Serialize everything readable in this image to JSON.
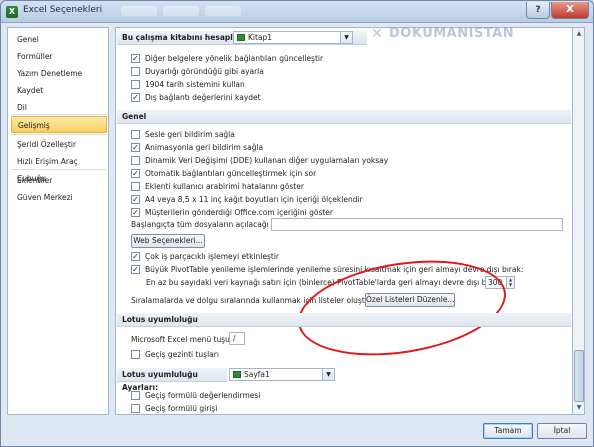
{
  "window": {
    "title": "Excel Seçenekleri",
    "help_label": "?",
    "close_label": "X"
  },
  "sidebar": {
    "items": [
      {
        "label": "Genel"
      },
      {
        "label": "Formüller"
      },
      {
        "label": "Yazım Denetleme"
      },
      {
        "label": "Kaydet"
      },
      {
        "label": "Dil"
      },
      {
        "label": "Gelişmiş"
      },
      {
        "label": "Şeridi Özelleştir"
      },
      {
        "label": "Hızlı Erişim Araç Çubuğu"
      },
      {
        "label": "Eklentiler"
      },
      {
        "label": "Güven Merkezi"
      }
    ],
    "active_index": 5
  },
  "watermark": {
    "text": "DOKUMANISTAN"
  },
  "workbook": {
    "label": "Bu çalışma kitabını hesaplarken:",
    "value": "Kitap1",
    "options": [
      {
        "label": "Diğer belgelere yönelik bağlantıları güncelleştir",
        "checked": true
      },
      {
        "label": "Duyarlığı göründüğü gibi ayarla",
        "checked": false
      },
      {
        "label": "1904 tarih sistemini kullan",
        "checked": false
      },
      {
        "label": "Dış bağlantı değerlerini kaydet",
        "checked": true
      }
    ]
  },
  "general": {
    "heading": "Genel",
    "options": [
      {
        "label": "Sesle geri bildirim sağla",
        "checked": false
      },
      {
        "label": "Animasyonla geri bildirim sağla",
        "checked": true
      },
      {
        "label": "Dinamik Veri Değişimi (DDE) kullanan diğer uygulamaları yoksay",
        "checked": false
      },
      {
        "label": "Otomatik bağlantıları güncelleştirmek için sor",
        "checked": true
      },
      {
        "label": "Eklenti kullanıcı arabirimi hatalarını göster",
        "checked": false
      },
      {
        "label": "A4 veya 8,5 x 11 inç kağıt boyutları için içeriği ölçeklendir",
        "checked": true
      },
      {
        "label": "Müşterilerin gönderdiği Office.com içeriğini göster",
        "checked": true
      }
    ],
    "startup_label": "Başlangıçta tüm dosyaların açılacağı yer:",
    "startup_value": "",
    "web_options_button": "Web Seçenekleri...",
    "options2": [
      {
        "label": "Çok iş parçacıklı işlemeyi etkinleştir",
        "checked": true
      },
      {
        "label": "Büyük PivotTable yenileme işlemlerinde yenileme süresini kısaltmak için geri almayı devre dışı bırak:",
        "checked": true
      }
    ],
    "pivot_rows_label": "En az bu sayıdaki veri kaynağı satırı için (binlerce) PivotTable'larda geri almayı devre dışı bırak:",
    "pivot_rows_value": "300",
    "custom_lists_label": "Sıralamalarda ve dolgu sıralarında kullanmak için listeler oluşturun:",
    "custom_lists_button": "Özel Listeleri Düzenle..."
  },
  "lotus": {
    "heading": "Lotus uyumluluğu",
    "menu_key_label": "Microsoft Excel menü tuşu:",
    "menu_key_value": "/",
    "transition_nav": {
      "label": "Geçiş gezinti tuşları",
      "checked": false
    }
  },
  "lotus_settings": {
    "heading": "Lotus uyumluluğu Ayarları:",
    "sheet_value": "Sayfa1",
    "options": [
      {
        "label": "Geçiş formülü değerlendirmesi",
        "checked": false
      },
      {
        "label": "Geçiş formülü girişi",
        "checked": false
      }
    ]
  },
  "footer": {
    "ok_label": "Tamam",
    "cancel_label": "İptal"
  },
  "colors": {
    "accent": "#f7cf62",
    "window_bg": "#dfe7f2",
    "highlight_circle": "#e0191b"
  }
}
